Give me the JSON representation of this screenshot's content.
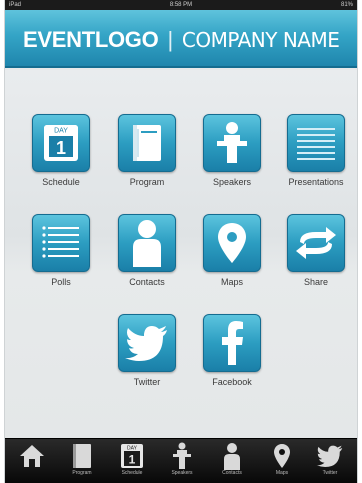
{
  "status_bar": {
    "carrier": "iPad",
    "time": "8:58 PM",
    "battery": "81%"
  },
  "header": {
    "logo": "EVENTLOGO",
    "separator": "|",
    "company": "COMPANY NAME"
  },
  "tiles": [
    {
      "label": "Schedule",
      "icon": "calendar-day-1-icon",
      "day_text": "DAY",
      "day_number": "1"
    },
    {
      "label": "Program",
      "icon": "notebook-icon"
    },
    {
      "label": "Speakers",
      "icon": "speaker-podium-icon"
    },
    {
      "label": "Presentations",
      "icon": "slides-lines-icon"
    },
    {
      "label": "Polls",
      "icon": "poll-list-icon"
    },
    {
      "label": "Contacts",
      "icon": "person-icon"
    },
    {
      "label": "Maps",
      "icon": "map-pin-icon"
    },
    {
      "label": "Share",
      "icon": "share-arrows-icon"
    },
    {
      "label": "Twitter",
      "icon": "twitter-bird-icon"
    },
    {
      "label": "Facebook",
      "icon": "facebook-f-icon"
    }
  ],
  "tabbar": {
    "items": [
      {
        "label": "",
        "icon": "home-icon"
      },
      {
        "label": "Program",
        "icon": "notebook-icon"
      },
      {
        "label": "Schedule",
        "icon": "calendar-icon",
        "day_text": "DAY",
        "day_number": "1"
      },
      {
        "label": "Speakers",
        "icon": "speaker-podium-icon"
      },
      {
        "label": "Contacts",
        "icon": "person-icon"
      },
      {
        "label": "Maps",
        "icon": "map-pin-icon"
      },
      {
        "label": "Twitter",
        "icon": "twitter-bird-icon"
      }
    ]
  },
  "colors": {
    "header_gradient_top": "#5fc3dc",
    "header_gradient_bottom": "#1f86ad",
    "tile_blue": "#2c9dc1",
    "tabbar_bg": "#111111"
  }
}
